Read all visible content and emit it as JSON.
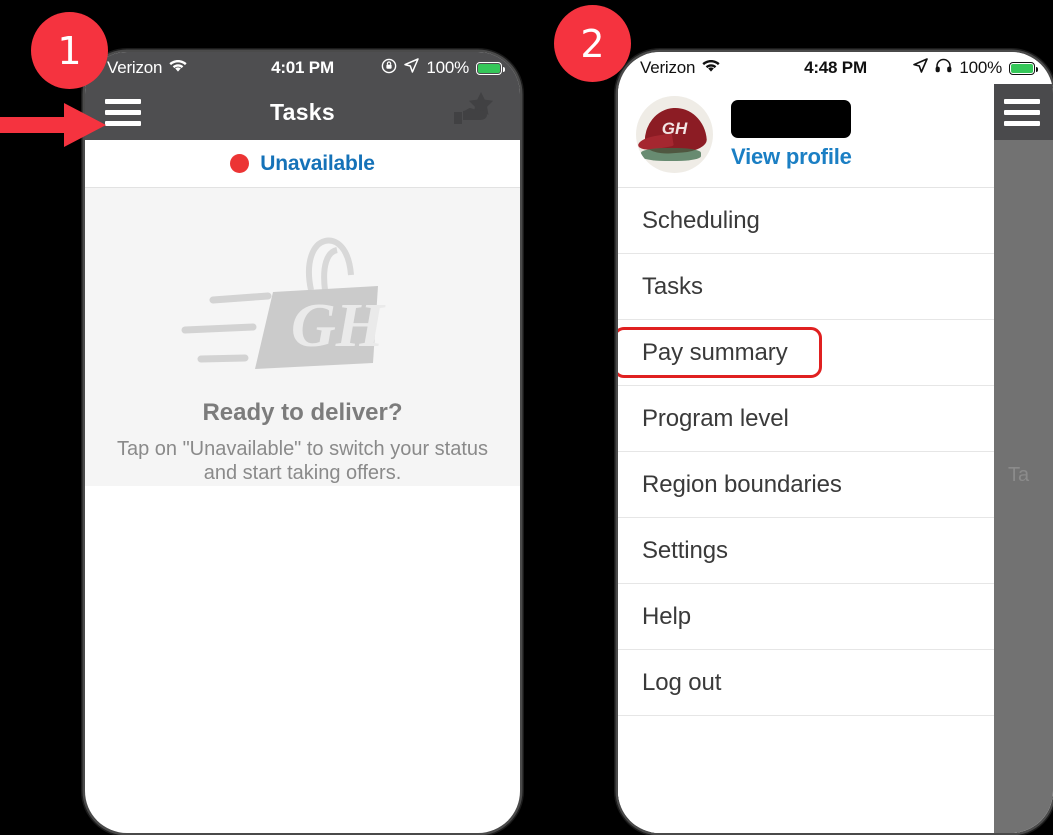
{
  "annotations": {
    "badges": [
      {
        "label": "1",
        "color": "#f5333f"
      },
      {
        "label": "2",
        "color": "#f5333f"
      }
    ],
    "arrow": {
      "name": "pointer-arrow",
      "color": "#f5333f",
      "points_to": "menu-button"
    },
    "highlight_color": "#e02020"
  },
  "phone1": {
    "status_bar": {
      "carrier": "Verizon",
      "wifi_icon": "wifi-icon",
      "time": "4:01 PM",
      "icons": [
        "rotation-lock-icon",
        "location-arrow-icon"
      ],
      "battery_percent": "100%",
      "battery_color": "#35c759"
    },
    "nav": {
      "menu_icon": "hamburger-menu-icon",
      "title": "Tasks",
      "right_icon": "star-hand-icon"
    },
    "availability": {
      "dot_color": "#ec3434",
      "label": "Unavailable",
      "label_color": "#1572b8"
    },
    "empty_state": {
      "illustration": "grubhub-delivery-bag-icon",
      "illustration_text": "GH",
      "title": "Ready to deliver?",
      "subtitle": "Tap on \"Unavailable\" to switch your status and start taking offers."
    }
  },
  "phone2": {
    "status_bar": {
      "carrier": "Verizon",
      "wifi_icon": "wifi-icon",
      "time": "4:48 PM",
      "icons": [
        "location-arrow-icon",
        "headphones-icon"
      ],
      "battery_percent": "100%",
      "battery_color": "#35c759"
    },
    "drawer": {
      "profile": {
        "avatar_icon": "grubhub-cap-avatar",
        "avatar_text": "GH",
        "name_redacted": true,
        "view_profile_label": "View profile",
        "view_profile_color": "#1b7fc4"
      },
      "items": [
        {
          "label": "Scheduling",
          "highlighted": false
        },
        {
          "label": "Tasks",
          "highlighted": false
        },
        {
          "label": "Pay summary",
          "highlighted": true
        },
        {
          "label": "Program level",
          "highlighted": false
        },
        {
          "label": "Region boundaries",
          "highlighted": false
        },
        {
          "label": "Settings",
          "highlighted": false
        },
        {
          "label": "Help",
          "highlighted": false
        },
        {
          "label": "Log out",
          "highlighted": false
        }
      ]
    },
    "scrim": {
      "menu_icon": "hamburger-menu-icon",
      "ghost_text": "Ta"
    }
  }
}
